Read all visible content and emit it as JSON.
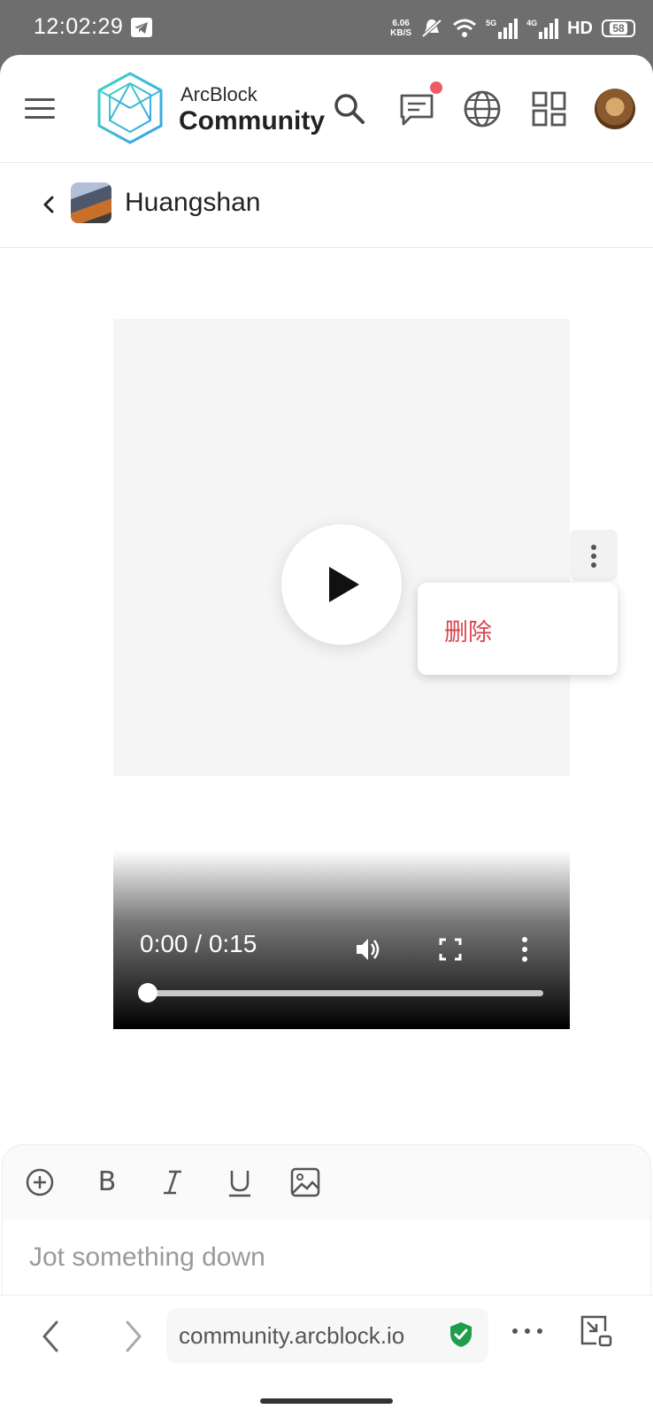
{
  "status_bar": {
    "time": "12:02:29",
    "net_speed_value": "6.06",
    "net_speed_unit": "KB/S",
    "sim1": "5G",
    "sim2": "4G",
    "hd": "HD",
    "battery": "58"
  },
  "header": {
    "brand_top": "ArcBlock",
    "brand_main": "Community",
    "notification_dot_color": "#ee5a67",
    "icons": [
      "menu-icon",
      "arcblock-logo",
      "search-icon",
      "chat-icon",
      "globe-icon",
      "apps-icon",
      "avatar"
    ]
  },
  "channel": {
    "title": "Huangshan"
  },
  "video": {
    "time_display": "0:00 / 0:15",
    "progress": 0.0
  },
  "context_menu": {
    "items": [
      {
        "label": "删除",
        "color": "#d9454f"
      }
    ]
  },
  "editor": {
    "toolbar": {
      "bold_label": "B"
    },
    "placeholder": "Jot something down"
  },
  "browser": {
    "url": "community.arcblock.io",
    "secure_icon_color": "#1e9e4a"
  }
}
